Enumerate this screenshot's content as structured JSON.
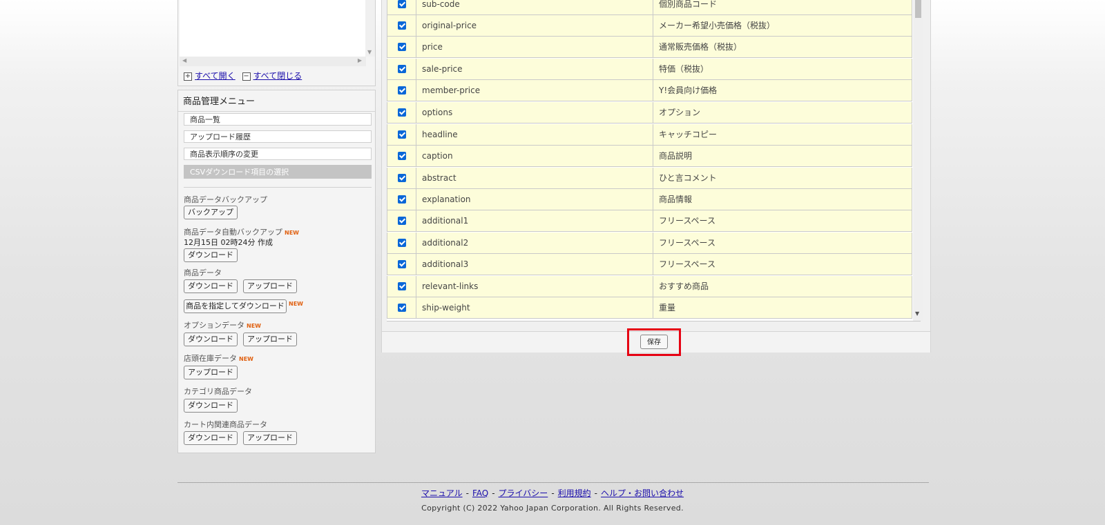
{
  "tree": {
    "expand_all": "すべて開く",
    "collapse_all": "すべて閉じる",
    "expand_sign": "+",
    "collapse_sign": "−"
  },
  "menu": {
    "title": "商品管理メニュー",
    "items": [
      {
        "label": "商品一覧"
      },
      {
        "label": "アップロード履歴"
      },
      {
        "label": "商品表示順序の変更"
      },
      {
        "label": "CSVダウンロード項目の選択",
        "active": true
      }
    ],
    "backup": {
      "label": "商品データバックアップ",
      "button": "バックアップ"
    },
    "auto_backup": {
      "label": "商品データ自動バックアップ",
      "new": "NEW",
      "info": "12月15日 02時24分 作成",
      "button": "ダウンロード"
    },
    "product_data": {
      "label": "商品データ",
      "download": "ダウンロード",
      "upload": "アップロード",
      "specified_download": "商品を指定してダウンロード",
      "new": "NEW"
    },
    "option_data": {
      "label": "オプションデータ",
      "new": "NEW",
      "download": "ダウンロード",
      "upload": "アップロード"
    },
    "store_stock": {
      "label": "店頭在庫データ",
      "new": "NEW",
      "upload": "アップロード"
    },
    "category_data": {
      "label": "カテゴリ商品データ",
      "download": "ダウンロード"
    },
    "cart_related": {
      "label": "カート内関連商品データ",
      "download": "ダウンロード",
      "upload": "アップロード"
    }
  },
  "table": {
    "rows": [
      {
        "key": "sub-code",
        "label": "個別商品コード",
        "checked": true
      },
      {
        "key": "original-price",
        "label": "メーカー希望小売価格（税抜）",
        "checked": true
      },
      {
        "key": "price",
        "label": "通常販売価格（税抜）",
        "checked": true
      },
      {
        "key": "sale-price",
        "label": "特価（税抜）",
        "checked": true
      },
      {
        "key": "member-price",
        "label": "Y!会員向け価格",
        "checked": true
      },
      {
        "key": "options",
        "label": "オプション",
        "checked": true
      },
      {
        "key": "headline",
        "label": "キャッチコピー",
        "checked": true
      },
      {
        "key": "caption",
        "label": "商品説明",
        "checked": true
      },
      {
        "key": "abstract",
        "label": "ひと言コメント",
        "checked": true
      },
      {
        "key": "explanation",
        "label": "商品情報",
        "checked": true
      },
      {
        "key": "additional1",
        "label": "フリースペース",
        "checked": true
      },
      {
        "key": "additional2",
        "label": "フリースペース",
        "checked": true
      },
      {
        "key": "additional3",
        "label": "フリースペース",
        "checked": true
      },
      {
        "key": "relevant-links",
        "label": "おすすめ商品",
        "checked": true
      },
      {
        "key": "ship-weight",
        "label": "重量",
        "checked": true
      }
    ]
  },
  "save_button": "保存",
  "footer": {
    "links": [
      "マニュアル",
      "FAQ",
      "プライバシー",
      "利用規約",
      "ヘルプ・お問い合わせ"
    ],
    "separator": "-",
    "copyright": "Copyright (C) 2022 Yahoo Japan Corporation. All Rights Reserved."
  },
  "colors": {
    "highlight": "#e60012",
    "row_bg": "#fdfdda",
    "checkbox": "#0a67d8",
    "new_badge": "#e06010"
  }
}
